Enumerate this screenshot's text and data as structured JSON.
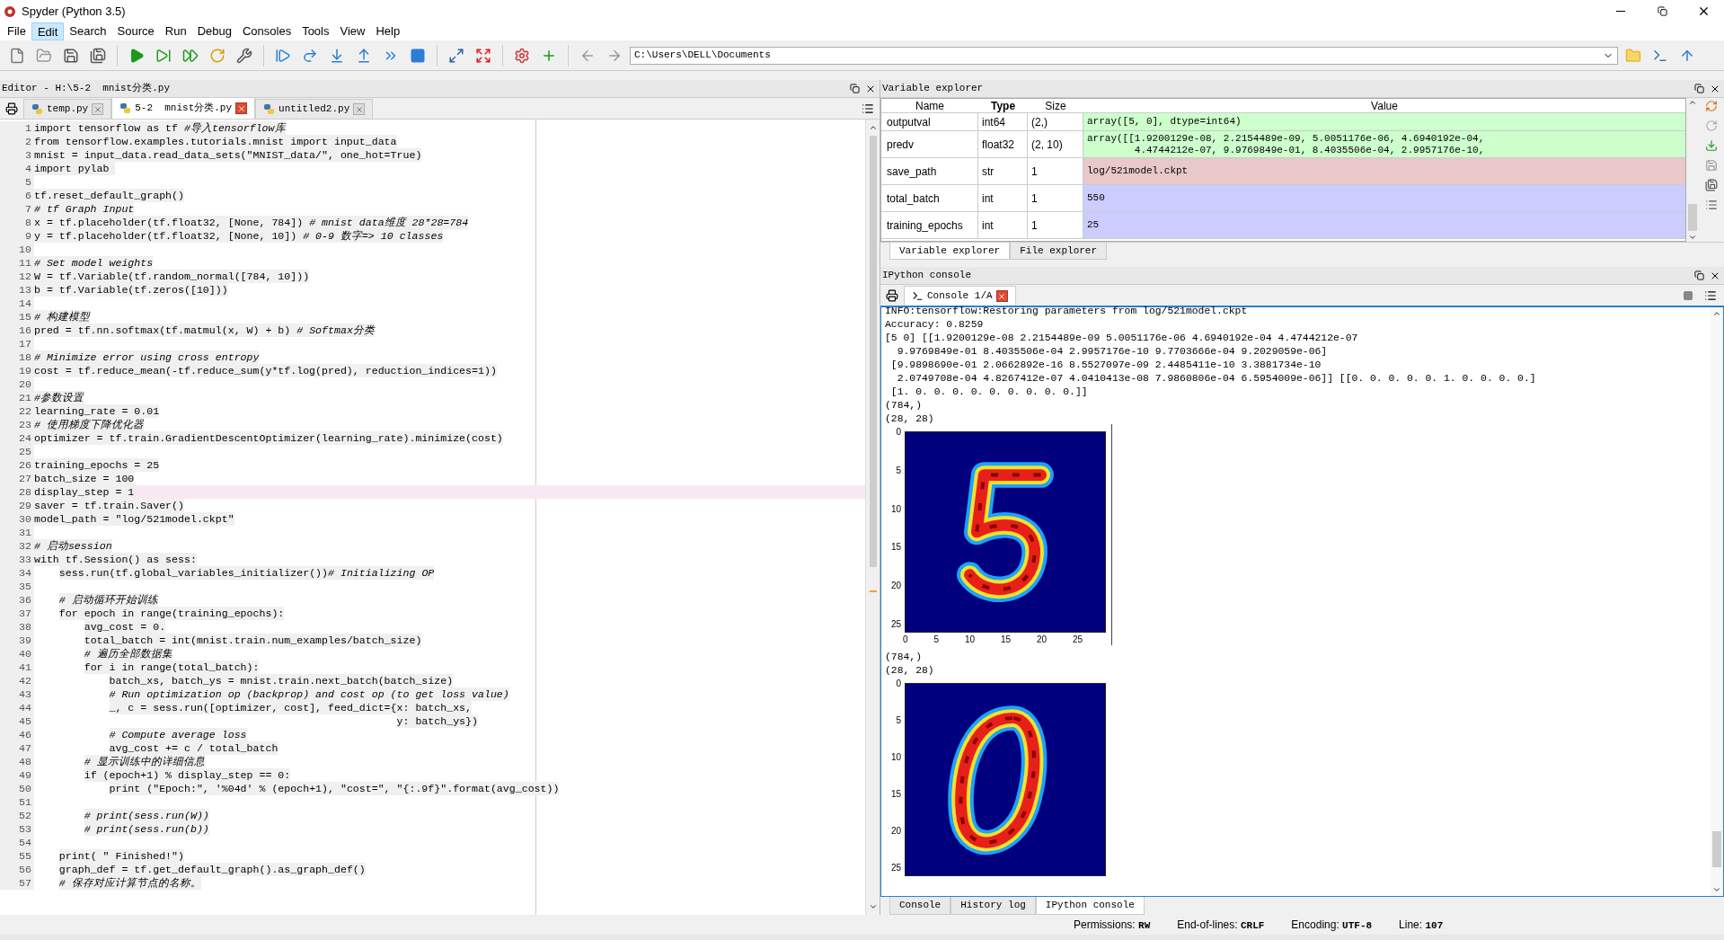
{
  "window": {
    "title": "Spyder (Python 3.5)"
  },
  "menu": [
    {
      "label": "File",
      "selected": false
    },
    {
      "label": "Edit",
      "selected": true
    },
    {
      "label": "Search",
      "selected": false
    },
    {
      "label": "Source",
      "selected": false
    },
    {
      "label": "Run",
      "selected": false
    },
    {
      "label": "Debug",
      "selected": false
    },
    {
      "label": "Consoles",
      "selected": false
    },
    {
      "label": "Tools",
      "selected": false
    },
    {
      "label": "View",
      "selected": false
    },
    {
      "label": "Help",
      "selected": false
    }
  ],
  "toolbar": {
    "path": "C:\\Users\\DELL\\Documents"
  },
  "editor": {
    "title": "Editor - H:\\5-2  mnist分类.py",
    "tabs": [
      {
        "label": "temp.py",
        "selected": false
      },
      {
        "label": "5-2  mnist分类.py",
        "selected": true
      },
      {
        "label": "untitled2.py",
        "selected": false
      }
    ],
    "lines": [
      {
        "n": "1",
        "code": "import tensorflow as tf ",
        "comment": "#导入tensorflow库",
        "current": false
      },
      {
        "n": "2",
        "code": "from tensorflow.examples.tutorials.mnist import input_data",
        "current": false
      },
      {
        "n": "3",
        "code": "mnist = input_data.read_data_sets(\"MNIST_data/\", one_hot=True)",
        "current": false
      },
      {
        "n": "4",
        "code": "import pylab ",
        "current": false
      },
      {
        "n": "5",
        "current": false
      },
      {
        "n": "6",
        "code": "tf.reset_default_graph()",
        "current": false
      },
      {
        "n": "7",
        "comment": "# tf Graph Input",
        "current": false
      },
      {
        "n": "8",
        "code": "x = tf.placeholder(tf.float32, [None, 784]) ",
        "comment": "# mnist data维度 28*28=784",
        "current": false
      },
      {
        "n": "9",
        "code": "y = tf.placeholder(tf.float32, [None, 10]) ",
        "comment": "# 0-9 数字=> 10 classes",
        "current": false
      },
      {
        "n": "10",
        "current": false
      },
      {
        "n": "11",
        "comment": "# Set model weights",
        "current": false
      },
      {
        "n": "12",
        "code": "W = tf.Variable(tf.random_normal([784, 10]))",
        "current": false
      },
      {
        "n": "13",
        "code": "b = tf.Variable(tf.zeros([10]))",
        "current": false
      },
      {
        "n": "14",
        "current": false
      },
      {
        "n": "15",
        "comment": "# 构建模型",
        "current": false
      },
      {
        "n": "16",
        "code": "pred = tf.nn.softmax(tf.matmul(x, W) + b) ",
        "comment": "# Softmax分类",
        "current": false
      },
      {
        "n": "17",
        "current": false
      },
      {
        "n": "18",
        "comment": "# Minimize error using cross entropy",
        "current": false
      },
      {
        "n": "19",
        "code": "cost = tf.reduce_mean(-tf.reduce_sum(y*tf.log(pred), reduction_indices=1))",
        "current": false
      },
      {
        "n": "20",
        "current": false
      },
      {
        "n": "21",
        "comment": "#参数设置",
        "current": false
      },
      {
        "n": "22",
        "code": "learning_rate = 0.01",
        "current": false
      },
      {
        "n": "23",
        "comment": "# 使用梯度下降优化器",
        "current": false
      },
      {
        "n": "24",
        "code": "optimizer = tf.train.GradientDescentOptimizer(learning_rate).minimize(cost)",
        "current": false
      },
      {
        "n": "25",
        "current": false
      },
      {
        "n": "26",
        "code": "training_epochs = 25",
        "current": false
      },
      {
        "n": "27",
        "code": "batch_size = 100",
        "current": false
      },
      {
        "n": "28",
        "code": "display_step = 1",
        "current": true
      },
      {
        "n": "29",
        "code": "saver = tf.train.Saver()",
        "current": false
      },
      {
        "n": "30",
        "code": "model_path = \"log/521model.ckpt\"",
        "current": false
      },
      {
        "n": "31",
        "current": false
      },
      {
        "n": "32",
        "comment": "# 启动session",
        "current": false
      },
      {
        "n": "33",
        "code": "with tf.Session() as sess:",
        "current": false
      },
      {
        "n": "34",
        "code": "    sess.run(tf.global_variables_initializer())",
        "comment": "# Initializing OP",
        "current": false
      },
      {
        "n": "35",
        "current": false
      },
      {
        "n": "36",
        "comment": "    # 启动循环开始训练",
        "current": false
      },
      {
        "n": "37",
        "code": "    for epoch in range(training_epochs):",
        "current": false
      },
      {
        "n": "38",
        "code": "        avg_cost = 0.",
        "current": false
      },
      {
        "n": "39",
        "code": "        total_batch = int(mnist.train.num_examples/batch_size)",
        "current": false
      },
      {
        "n": "40",
        "comment": "        # 遍历全部数据集",
        "current": false
      },
      {
        "n": "41",
        "code": "        for i in range(total_batch):",
        "current": false
      },
      {
        "n": "42",
        "code": "            batch_xs, batch_ys = mnist.train.next_batch(batch_size)",
        "current": false
      },
      {
        "n": "43",
        "comment": "            # Run optimization op (backprop) and cost op (to get loss value)",
        "current": false
      },
      {
        "n": "44",
        "code": "            _, c = sess.run([optimizer, cost], feed_dict={x: batch_xs,",
        "current": false
      },
      {
        "n": "45",
        "code": "                                                          y: batch_ys})",
        "current": false
      },
      {
        "n": "46",
        "comment": "            # Compute average loss",
        "current": false
      },
      {
        "n": "47",
        "code": "            avg_cost += c / total_batch",
        "current": false
      },
      {
        "n": "48",
        "comment": "        # 显示训练中的详细信息",
        "current": false
      },
      {
        "n": "49",
        "code": "        if (epoch+1) % display_step == 0:",
        "current": false
      },
      {
        "n": "50",
        "code": "            print (\"Epoch:\", '%04d' % (epoch+1), \"cost=\", \"{:.9f}\".format(avg_cost))",
        "current": false
      },
      {
        "n": "51",
        "current": false
      },
      {
        "n": "52",
        "comment": "        # print(sess.run(W))",
        "current": false
      },
      {
        "n": "53",
        "comment": "        # print(sess.run(b))",
        "current": false
      },
      {
        "n": "54",
        "current": false
      },
      {
        "n": "55",
        "code": "    print( \" Finished!\")",
        "current": false
      },
      {
        "n": "56",
        "code": "    graph_def = tf.get_default_graph().as_graph_def()",
        "current": false
      },
      {
        "n": "57",
        "comment": "    # 保存对应计算节点的名称。",
        "current": false
      }
    ]
  },
  "variable_explorer": {
    "title": "Variable explorer",
    "columns": [
      "Name",
      "Type",
      "Size",
      "Value"
    ],
    "rows": [
      {
        "name": "outputval",
        "type": "int64",
        "size": "(2,)",
        "value": [
          "array([5, 0], dtype=int64)"
        ],
        "color": "#ccffcc"
      },
      {
        "name": "predv",
        "type": "float32",
        "size": "(2, 10)",
        "value": [
          "array([[1.9200129e-08, 2.2154489e-09, 5.0051176e-06, 4.6940192e-04,",
          "        4.4744212e-07, 9.9769849e-01, 8.4035506e-04, 2.9957176e-10,"
        ],
        "color": "#ccffcc"
      },
      {
        "name": "save_path",
        "type": "str",
        "size": "1",
        "value": [
          "log/521model.ckpt"
        ],
        "color": "#e8c8c8"
      },
      {
        "name": "total_batch",
        "type": "int",
        "size": "1",
        "value": [
          "550"
        ],
        "color": "#ccccff"
      },
      {
        "name": "training_epochs",
        "type": "int",
        "size": "1",
        "value": [
          "25"
        ],
        "color": "#ccccff"
      }
    ],
    "tabs": [
      {
        "label": "Variable explorer",
        "selected": true
      },
      {
        "label": "File explorer",
        "selected": false
      }
    ]
  },
  "console": {
    "title": "IPython console",
    "tab": "Console 1/A",
    "output": [
      {
        "kind": "text",
        "lines": [
          "INFO:tensorflow:Restoring parameters from log/521model.ckpt",
          "Accuracy: 0.8259",
          "[5 0] [[1.9200129e-08 2.2154489e-09 5.0051176e-06 4.6940192e-04 4.4744212e-07",
          "  9.9769849e-01 8.4035506e-04 2.9957176e-10 9.7703666e-04 9.2029059e-06]",
          " [9.9898690e-01 2.0662892e-16 8.5527097e-09 2.4485411e-10 3.3881734e-10",
          "  2.0749708e-04 4.8267412e-07 4.0410413e-08 7.9860806e-04 6.5954009e-06]] [[0. 0. 0. 0. 0. 1. 0. 0. 0. 0.]",
          " [1. 0. 0. 0. 0. 0. 0. 0. 0. 0.]]",
          "(784,)",
          "(28, 28)"
        ]
      },
      {
        "kind": "plot",
        "yticks": [
          "0",
          "5",
          "10",
          "15",
          "20",
          "25"
        ],
        "xticks": [
          "0",
          "5",
          "10",
          "15",
          "20",
          "25"
        ]
      },
      {
        "kind": "text",
        "lines": [
          "(784,)",
          "(28, 28)"
        ]
      },
      {
        "kind": "plot",
        "yticks": [
          "0",
          "5",
          "10",
          "15",
          "20",
          "25"
        ]
      }
    ],
    "tabs": [
      {
        "label": "Console",
        "selected": false
      },
      {
        "label": "History log",
        "selected": false
      },
      {
        "label": "IPython console",
        "selected": true
      }
    ]
  },
  "status_bar": [
    {
      "label": "Permissions:",
      "value": "RW"
    },
    {
      "label": "End-of-lines:",
      "value": "CRLF"
    },
    {
      "label": "Encoding:",
      "value": "UTF-8"
    },
    {
      "label": "Line:",
      "value": "107"
    }
  ]
}
